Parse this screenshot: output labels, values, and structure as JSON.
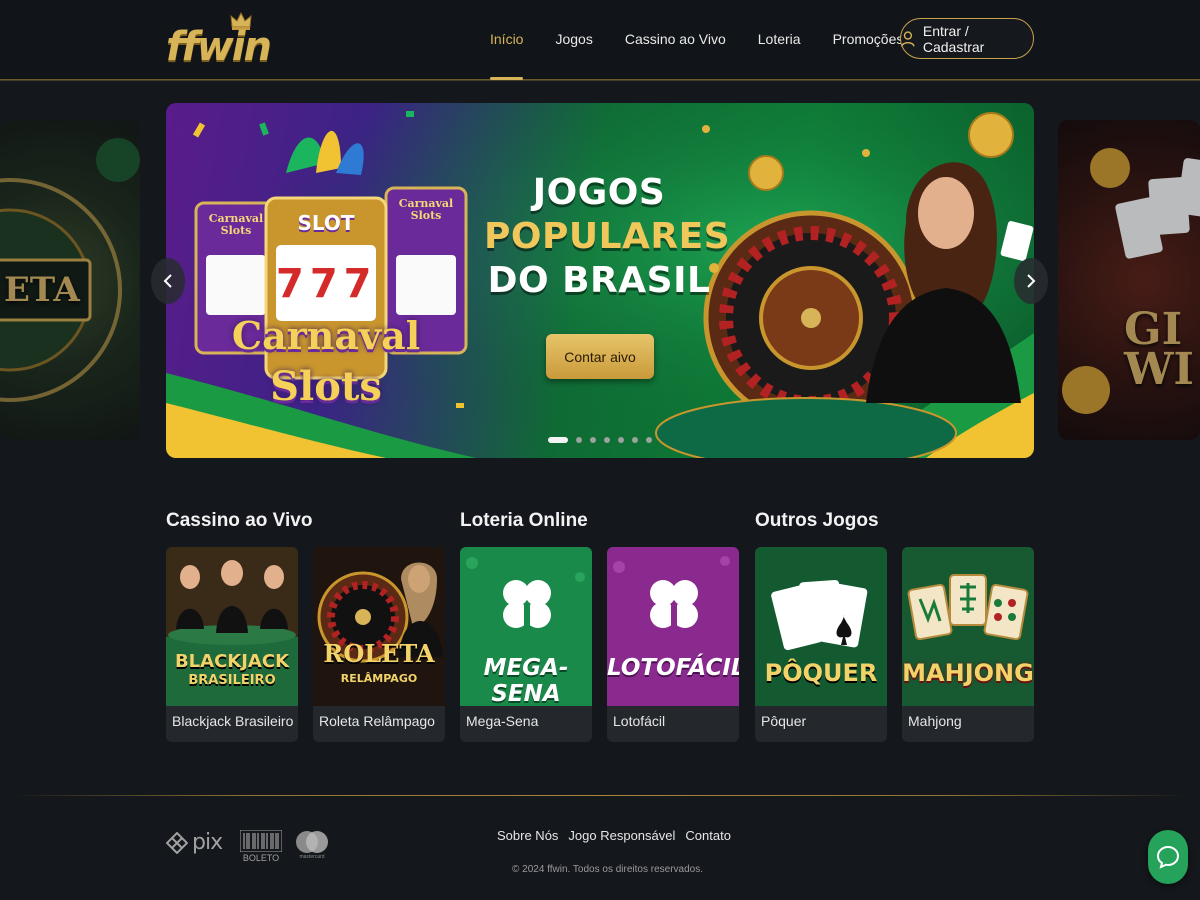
{
  "header": {
    "logo": "ffwin",
    "nav": [
      "Início",
      "Jogos",
      "Cassino ao Vivo",
      "Loteria",
      "Promoções"
    ],
    "active_nav": "Início",
    "login_label": "Entrar / Cadastrar",
    "accent_color": "#d8b458"
  },
  "carousel": {
    "left_card_text": "ETA",
    "right_card_text": "GI WI",
    "banner": {
      "slot_badges": [
        "Carnaval Slots",
        "SLOT",
        "Carnaval Slots"
      ],
      "reels": "777",
      "logo_line1": "Carnaval",
      "logo_line2": "Slots",
      "title_line1": "JOGOS",
      "title_line2": "POPULARES",
      "title_line3": "DO BRASIL",
      "cta_label": "Contar aivo"
    },
    "prev_icon": "chevron-left-icon",
    "next_icon": "chevron-right-icon",
    "dot_count": 7,
    "active_dot": 0
  },
  "sections": [
    {
      "title": "Cassino ao Vivo"
    },
    {
      "title": "Loteria Online"
    },
    {
      "title": "Outros Jogos"
    }
  ],
  "cards": [
    {
      "name": "Blackjack Brasileiro",
      "art_line1": "BLACKJACK",
      "art_line2": "BRASILEIRO",
      "bg": "#1f5a35"
    },
    {
      "name": "Roleta Relâmpago",
      "art_line1": "ROLETA",
      "art_line2": "RELÂMPAGO",
      "bg": "#2a1a12"
    },
    {
      "name": "Mega-Sena",
      "art_line1": "MEGA-SENA",
      "bg": "#1a8a4a"
    },
    {
      "name": "Lotofácil",
      "art_line1": "LOTOFÁCIL",
      "bg": "#8a2a8e"
    },
    {
      "name": "Pôquer",
      "art_line1": "PÔQUER",
      "bg": "#145a30"
    },
    {
      "name": "Mahjong",
      "art_line1": "MAHJONG",
      "bg": "#175a32"
    }
  ],
  "footer": {
    "payments": [
      "pix",
      "BOLETO",
      "mastercard"
    ],
    "links": [
      "Sobre Nós",
      "Jogo Responsável",
      "Contato"
    ],
    "copyright": "© 2024 ffwin. Todos os direitos reservados.",
    "chat_icon": "chat-icon"
  }
}
